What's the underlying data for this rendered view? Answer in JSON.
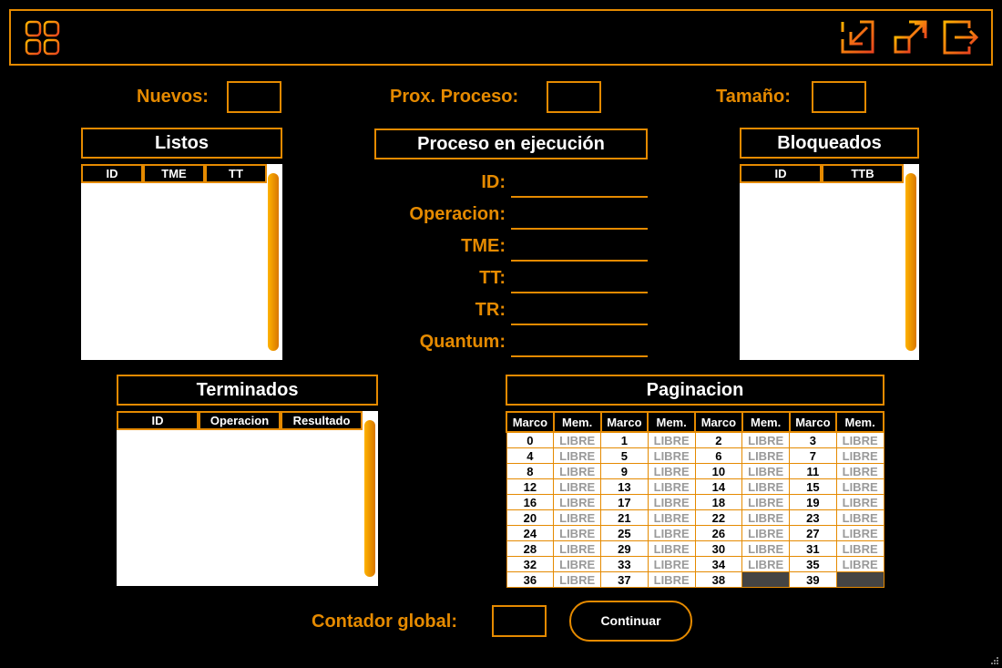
{
  "header": {
    "icons": [
      "menu-grid-icon",
      "minimize-icon",
      "maximize-icon",
      "exit-icon"
    ],
    "accent": "#e58a00"
  },
  "top": {
    "nuevos_label": "Nuevos:",
    "prox_label": "Prox. Proceso:",
    "tamano_label": "Tamaño:"
  },
  "listos": {
    "title": "Listos",
    "columns": [
      "ID",
      "TME",
      "TT"
    ]
  },
  "bloqueados": {
    "title": "Bloqueados",
    "columns": [
      "ID",
      "TTB"
    ]
  },
  "ejecucion": {
    "title": "Proceso en ejecución",
    "fields": [
      "ID:",
      "Operacion:",
      "TME:",
      "TT:",
      "TR:",
      "Quantum:"
    ]
  },
  "terminados": {
    "title": "Terminados",
    "columns": [
      "ID",
      "Operacion",
      "Resultado"
    ]
  },
  "paginacion": {
    "title": "Paginacion",
    "columns": [
      "Marco",
      "Mem.",
      "Marco",
      "Mem.",
      "Marco",
      "Mem.",
      "Marco",
      "Mem."
    ],
    "free_label": "LIBRE",
    "rows": [
      [
        [
          "0",
          "LIBRE"
        ],
        [
          "1",
          "LIBRE"
        ],
        [
          "2",
          "LIBRE"
        ],
        [
          "3",
          "LIBRE"
        ]
      ],
      [
        [
          "4",
          "LIBRE"
        ],
        [
          "5",
          "LIBRE"
        ],
        [
          "6",
          "LIBRE"
        ],
        [
          "7",
          "LIBRE"
        ]
      ],
      [
        [
          "8",
          "LIBRE"
        ],
        [
          "9",
          "LIBRE"
        ],
        [
          "10",
          "LIBRE"
        ],
        [
          "11",
          "LIBRE"
        ]
      ],
      [
        [
          "12",
          "LIBRE"
        ],
        [
          "13",
          "LIBRE"
        ],
        [
          "14",
          "LIBRE"
        ],
        [
          "15",
          "LIBRE"
        ]
      ],
      [
        [
          "16",
          "LIBRE"
        ],
        [
          "17",
          "LIBRE"
        ],
        [
          "18",
          "LIBRE"
        ],
        [
          "19",
          "LIBRE"
        ]
      ],
      [
        [
          "20",
          "LIBRE"
        ],
        [
          "21",
          "LIBRE"
        ],
        [
          "22",
          "LIBRE"
        ],
        [
          "23",
          "LIBRE"
        ]
      ],
      [
        [
          "24",
          "LIBRE"
        ],
        [
          "25",
          "LIBRE"
        ],
        [
          "26",
          "LIBRE"
        ],
        [
          "27",
          "LIBRE"
        ]
      ],
      [
        [
          "28",
          "LIBRE"
        ],
        [
          "29",
          "LIBRE"
        ],
        [
          "30",
          "LIBRE"
        ],
        [
          "31",
          "LIBRE"
        ]
      ],
      [
        [
          "32",
          "LIBRE"
        ],
        [
          "33",
          "LIBRE"
        ],
        [
          "34",
          "LIBRE"
        ],
        [
          "35",
          "LIBRE"
        ]
      ],
      [
        [
          "36",
          "LIBRE"
        ],
        [
          "37",
          "LIBRE"
        ],
        [
          "38",
          ""
        ],
        [
          "39",
          ""
        ]
      ]
    ]
  },
  "footer": {
    "contador_label": "Contador global:",
    "continuar_label": "Continuar"
  }
}
